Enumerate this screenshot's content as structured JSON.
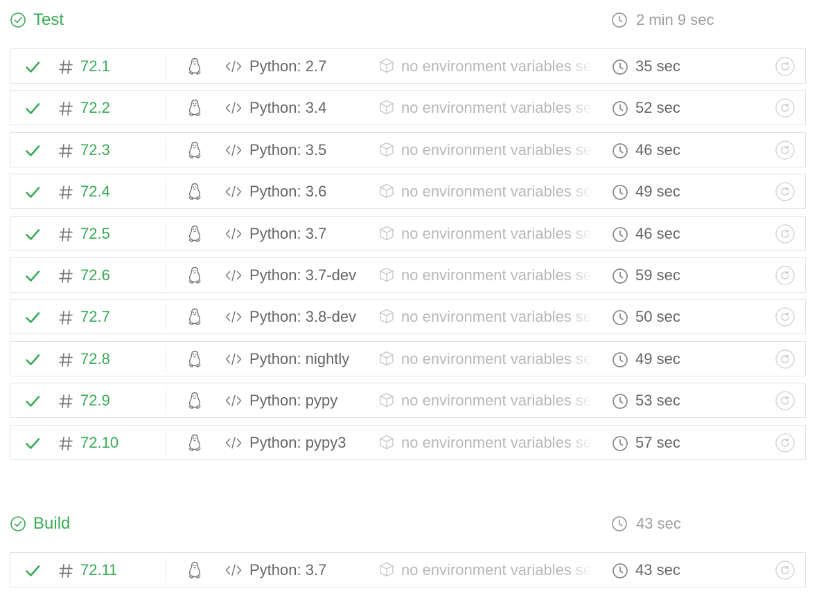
{
  "colors": {
    "passed": "#39aa56",
    "muted": "#9d9d9d",
    "border": "#e4e4e4"
  },
  "icons": {
    "passed": "check-circle-icon",
    "job_passed": "check-icon",
    "job_number": "hash-icon",
    "os": "linux-penguin-icon",
    "language": "code-icon",
    "env": "cube-icon",
    "duration": "clock-icon",
    "restart": "restart-icon"
  },
  "stages": [
    {
      "name": "Test",
      "duration": "2 min 9 sec",
      "jobs": [
        {
          "number": "72.1",
          "language": "Python: 2.7",
          "env": "no environment variables set",
          "duration": "35 sec"
        },
        {
          "number": "72.2",
          "language": "Python: 3.4",
          "env": "no environment variables set",
          "duration": "52 sec"
        },
        {
          "number": "72.3",
          "language": "Python: 3.5",
          "env": "no environment variables set",
          "duration": "46 sec"
        },
        {
          "number": "72.4",
          "language": "Python: 3.6",
          "env": "no environment variables set",
          "duration": "49 sec"
        },
        {
          "number": "72.5",
          "language": "Python: 3.7",
          "env": "no environment variables set",
          "duration": "46 sec"
        },
        {
          "number": "72.6",
          "language": "Python: 3.7-dev",
          "env": "no environment variables set",
          "duration": "59 sec"
        },
        {
          "number": "72.7",
          "language": "Python: 3.8-dev",
          "env": "no environment variables set",
          "duration": "50 sec"
        },
        {
          "number": "72.8",
          "language": "Python: nightly",
          "env": "no environment variables set",
          "duration": "49 sec"
        },
        {
          "number": "72.9",
          "language": "Python: pypy",
          "env": "no environment variables set",
          "duration": "53 sec"
        },
        {
          "number": "72.10",
          "language": "Python: pypy3",
          "env": "no environment variables set",
          "duration": "57 sec"
        }
      ]
    },
    {
      "name": "Build",
      "duration": "43 sec",
      "jobs": [
        {
          "number": "72.11",
          "language": "Python: 3.7",
          "env": "no environment variables set",
          "duration": "43 sec"
        }
      ]
    }
  ]
}
